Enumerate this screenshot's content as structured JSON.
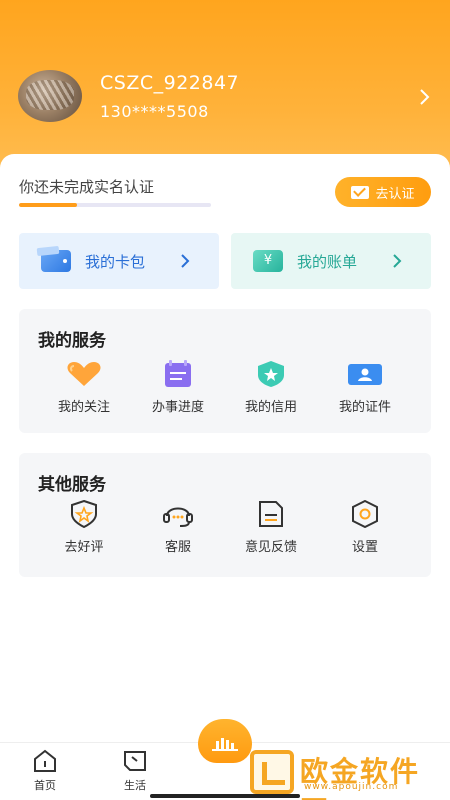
{
  "profile": {
    "username": "CSZC_922847",
    "phone": "130****5508"
  },
  "verification": {
    "prompt": "你还未完成实名认证",
    "button_label": "去认证",
    "progress": 0.3
  },
  "quick_links": [
    {
      "label": "我的卡包",
      "icon": "wallet-icon"
    },
    {
      "label": "我的账单",
      "icon": "bill-icon",
      "icon_glyph": "¥"
    }
  ],
  "my_services": {
    "title": "我的服务",
    "items": [
      {
        "label": "我的关注",
        "icon": "heart-icon"
      },
      {
        "label": "办事进度",
        "icon": "progress-calendar-icon"
      },
      {
        "label": "我的信用",
        "icon": "credit-shield-icon"
      },
      {
        "label": "我的证件",
        "icon": "id-card-icon"
      }
    ]
  },
  "other_services": {
    "title": "其他服务",
    "items": [
      {
        "label": "去好评",
        "icon": "star-shield-icon"
      },
      {
        "label": "客服",
        "icon": "headset-icon"
      },
      {
        "label": "意见反馈",
        "icon": "feedback-doc-icon"
      },
      {
        "label": "设置",
        "icon": "settings-hexagon-icon"
      }
    ]
  },
  "tabbar": {
    "tabs": [
      {
        "label": "首页",
        "icon": "home-icon"
      },
      {
        "label": "生活",
        "icon": "life-icon"
      }
    ]
  },
  "watermark": {
    "text": "欧金软件园",
    "url": "www.apoujin.com"
  },
  "colors": {
    "brand_orange": "#ffa51e",
    "wallet_blue": "#2a6fd6",
    "bill_teal": "#27a896"
  }
}
